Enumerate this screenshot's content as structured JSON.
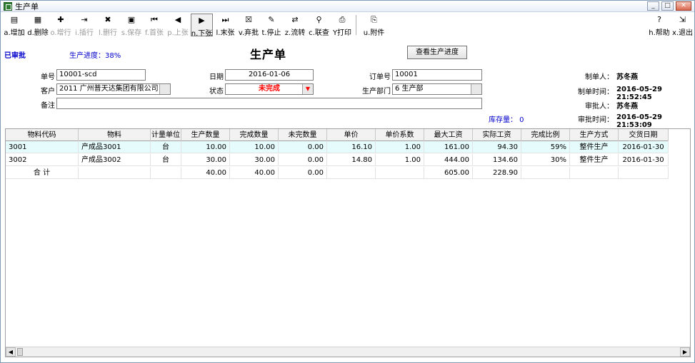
{
  "window": {
    "title": "生产单"
  },
  "title_controls": {
    "minimize": "_",
    "restore": "□",
    "close": "✕"
  },
  "toolbar": {
    "buttons": [
      {
        "label": "a.增加",
        "icon": "new-doc-icon",
        "glyph": "▤",
        "disabled": false
      },
      {
        "label": "d.删除",
        "icon": "delete-doc-icon",
        "glyph": "▦",
        "disabled": false
      },
      {
        "label": "o.增行",
        "icon": "add-row-icon",
        "glyph": "✚",
        "disabled": true
      },
      {
        "label": "i.插行",
        "icon": "insert-row-icon",
        "glyph": "⇥",
        "disabled": true
      },
      {
        "label": "l.删行",
        "icon": "delete-row-icon",
        "glyph": "✖",
        "disabled": true
      },
      {
        "label": "s.保存",
        "icon": "save-icon",
        "glyph": "▣",
        "disabled": true
      },
      {
        "label": "f.首张",
        "icon": "first-record-icon",
        "glyph": "⏮",
        "disabled": true
      },
      {
        "label": "p.上张",
        "icon": "prev-record-icon",
        "glyph": "◀",
        "disabled": true
      },
      {
        "label": "n.下张",
        "icon": "next-record-icon",
        "glyph": "▶",
        "disabled": false,
        "pressed": true
      },
      {
        "label": "l.末张",
        "icon": "last-record-icon",
        "glyph": "⏭",
        "disabled": false
      },
      {
        "label": "v.弃批",
        "icon": "unapprove-icon",
        "glyph": "☒",
        "disabled": false
      },
      {
        "label": "t.停止",
        "icon": "stop-icon",
        "glyph": "✎",
        "disabled": false
      },
      {
        "label": "z.流转",
        "icon": "transfer-icon",
        "glyph": "⇄",
        "disabled": false
      },
      {
        "label": "c.联查",
        "icon": "query-icon",
        "glyph": "⚲",
        "disabled": false
      },
      {
        "label": "Y打印",
        "icon": "print-icon",
        "glyph": "⎙",
        "disabled": false
      },
      {
        "label": "u.附件",
        "icon": "attachment-icon",
        "glyph": "⎘",
        "disabled": false
      }
    ],
    "help_label": "h.帮助",
    "exit_label": "x.退出"
  },
  "header": {
    "approval_status": "已审批",
    "progress_text": "生产进度：38%",
    "doc_title": "生产单",
    "view_progress_button": "查看生产进度"
  },
  "form": {
    "order_no_label": "单号",
    "order_no_value": "10001-scd",
    "date_label": "日期",
    "date_value": "2016-01-06",
    "po_no_label": "订单号",
    "po_no_value": "10001",
    "customer_label": "客户",
    "customer_value": "2011 广州普天达集团有限公司",
    "status_label": "状态",
    "status_value": "未完成",
    "status_color": "#ff0000",
    "dept_label": "生产部门",
    "dept_value": "6 生产部",
    "remark_label": "备注",
    "remark_value": ""
  },
  "audit": {
    "maker_label": "制单人：",
    "maker_value": "苏冬燕",
    "make_time_label": "制单时间：",
    "make_time_value": "2016-05-29 21:52:45",
    "approver_label": "审批人：",
    "approver_value": "苏冬燕",
    "approve_time_label": "审批时间：",
    "approve_time_value": "2016-05-29 21:53:09",
    "stock_text": "库存量：  0"
  },
  "grid": {
    "columns": [
      "物料代码",
      "物料",
      "计量单位",
      "生产数量",
      "完成数量",
      "未完数量",
      "单价",
      "单价系数",
      "最大工资",
      "实际工资",
      "完成比例",
      "生产方式",
      "交货日期"
    ],
    "rows": [
      [
        "3001",
        "产成品3001",
        "台",
        "10.00",
        "10.00",
        "0.00",
        "16.10",
        "1.00",
        "161.00",
        "94.30",
        "59%",
        "整件生产",
        "2016-01-30"
      ],
      [
        "3002",
        "产成品3002",
        "台",
        "30.00",
        "30.00",
        "0.00",
        "14.80",
        "1.00",
        "444.00",
        "134.60",
        "30%",
        "整件生产",
        "2016-01-30"
      ],
      [
        "合  计",
        "",
        "",
        "40.00",
        "40.00",
        "0.00",
        "",
        "",
        "605.00",
        "228.90",
        "",
        "",
        ""
      ]
    ]
  },
  "scrollbar": {
    "left_arrow": "◀",
    "right_arrow": "▶"
  }
}
